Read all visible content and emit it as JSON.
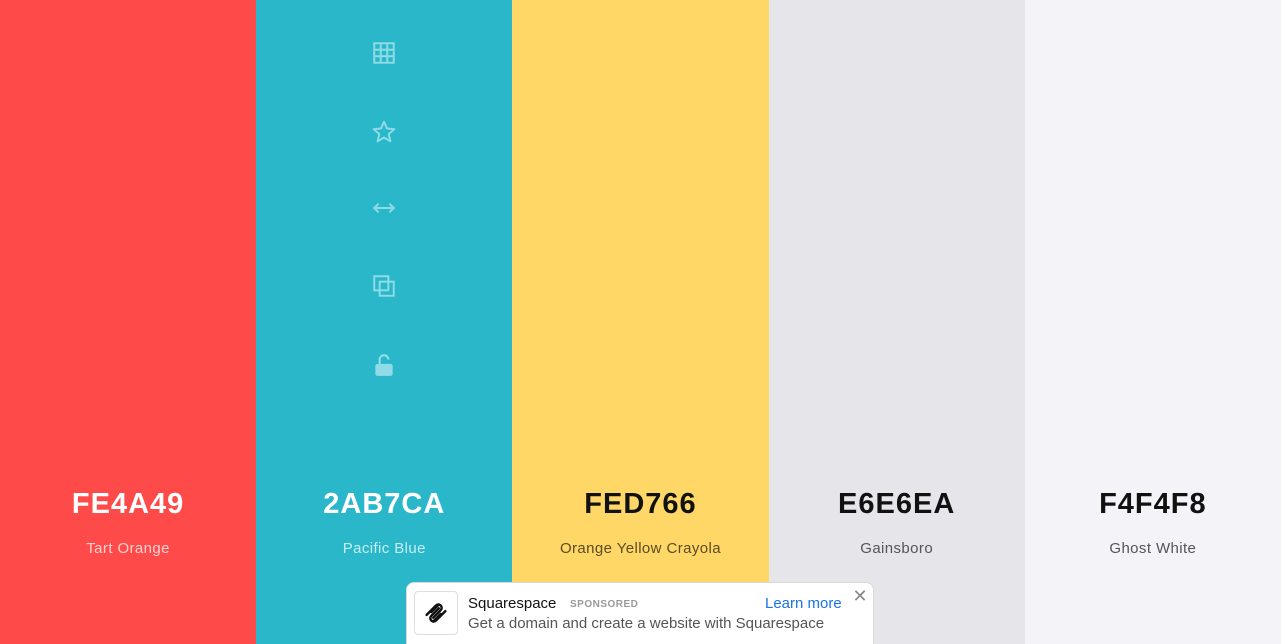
{
  "palette": {
    "colors": [
      {
        "hex": "FE4A49",
        "name": "Tart Orange",
        "bg": "#FE4A49",
        "hex_color": "#ffffff",
        "name_color": "#ffd2d1"
      },
      {
        "hex": "2AB7CA",
        "name": "Pacific Blue",
        "bg": "#2AB7CA",
        "hex_color": "#ffffff",
        "name_color": "#c4eef3"
      },
      {
        "hex": "FED766",
        "name": "Orange Yellow Crayola",
        "bg": "#FED766",
        "hex_color": "#111111",
        "name_color": "#5a4c24"
      },
      {
        "hex": "E6E6EA",
        "name": "Gainsboro",
        "bg": "#E6E6EA",
        "hex_color": "#111111",
        "name_color": "#555555"
      },
      {
        "hex": "F4F4F8",
        "name": "Ghost White",
        "bg": "#F4F4F8",
        "hex_color": "#111111",
        "name_color": "#555555"
      }
    ],
    "tools": [
      {
        "icon": "grid-icon"
      },
      {
        "icon": "star-icon"
      },
      {
        "icon": "drag-horizontal-icon"
      },
      {
        "icon": "copy-icon"
      },
      {
        "icon": "unlock-icon"
      }
    ],
    "tool_color": "#8fdbe6"
  },
  "ad": {
    "title": "Squarespace",
    "sponsored": "SPONSORED",
    "cta": "Learn more",
    "description": "Get a domain and create a website with Squarespace",
    "close": "✕"
  }
}
